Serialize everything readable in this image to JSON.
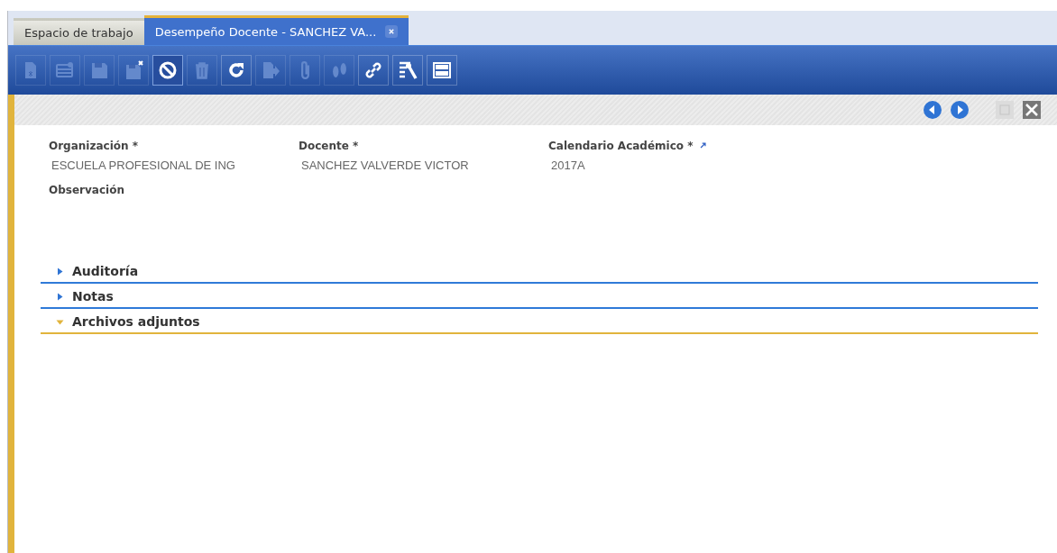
{
  "tabs": [
    {
      "label": "Espacio de trabajo",
      "selected": false,
      "closable": false
    },
    {
      "label": "Desempeño Docente - SANCHEZ VA...",
      "selected": true,
      "closable": true
    }
  ],
  "toolbar": [
    {
      "kind": "new",
      "disabled": true
    },
    {
      "kind": "grid",
      "disabled": true
    },
    {
      "kind": "save",
      "disabled": true
    },
    {
      "kind": "savenew",
      "disabled": true
    },
    {
      "kind": "ignore",
      "disabled": false,
      "selected": true
    },
    {
      "kind": "delete",
      "disabled": true
    },
    {
      "kind": "refresh",
      "disabled": false
    },
    {
      "kind": "report",
      "disabled": true
    },
    {
      "kind": "attach",
      "disabled": true
    },
    {
      "kind": "steps",
      "disabled": true
    },
    {
      "kind": "link",
      "disabled": false
    },
    {
      "kind": "customize",
      "disabled": false
    },
    {
      "kind": "toggle",
      "disabled": false
    }
  ],
  "nav": [
    {
      "kind": "previous",
      "disabled": false
    },
    {
      "kind": "next",
      "disabled": false
    },
    {
      "kind": "maximize",
      "disabled": true
    },
    {
      "kind": "close",
      "disabled": false
    }
  ],
  "fields": [
    {
      "label": "Organización *",
      "value": "ESCUELA PROFESIONAL DE ING",
      "zoom": false
    },
    {
      "label": "Docente *",
      "value": "SANCHEZ VALVERDE VICTOR",
      "zoom": false
    },
    {
      "label": "Calendario Académico *",
      "value": "2017A",
      "zoom": true
    }
  ],
  "observation": {
    "label": "Observación"
  },
  "sections": [
    {
      "title": "Auditoría",
      "expanded": false
    },
    {
      "title": "Notas",
      "expanded": false
    },
    {
      "title": "Archivos adjuntos",
      "expanded": true
    }
  ]
}
